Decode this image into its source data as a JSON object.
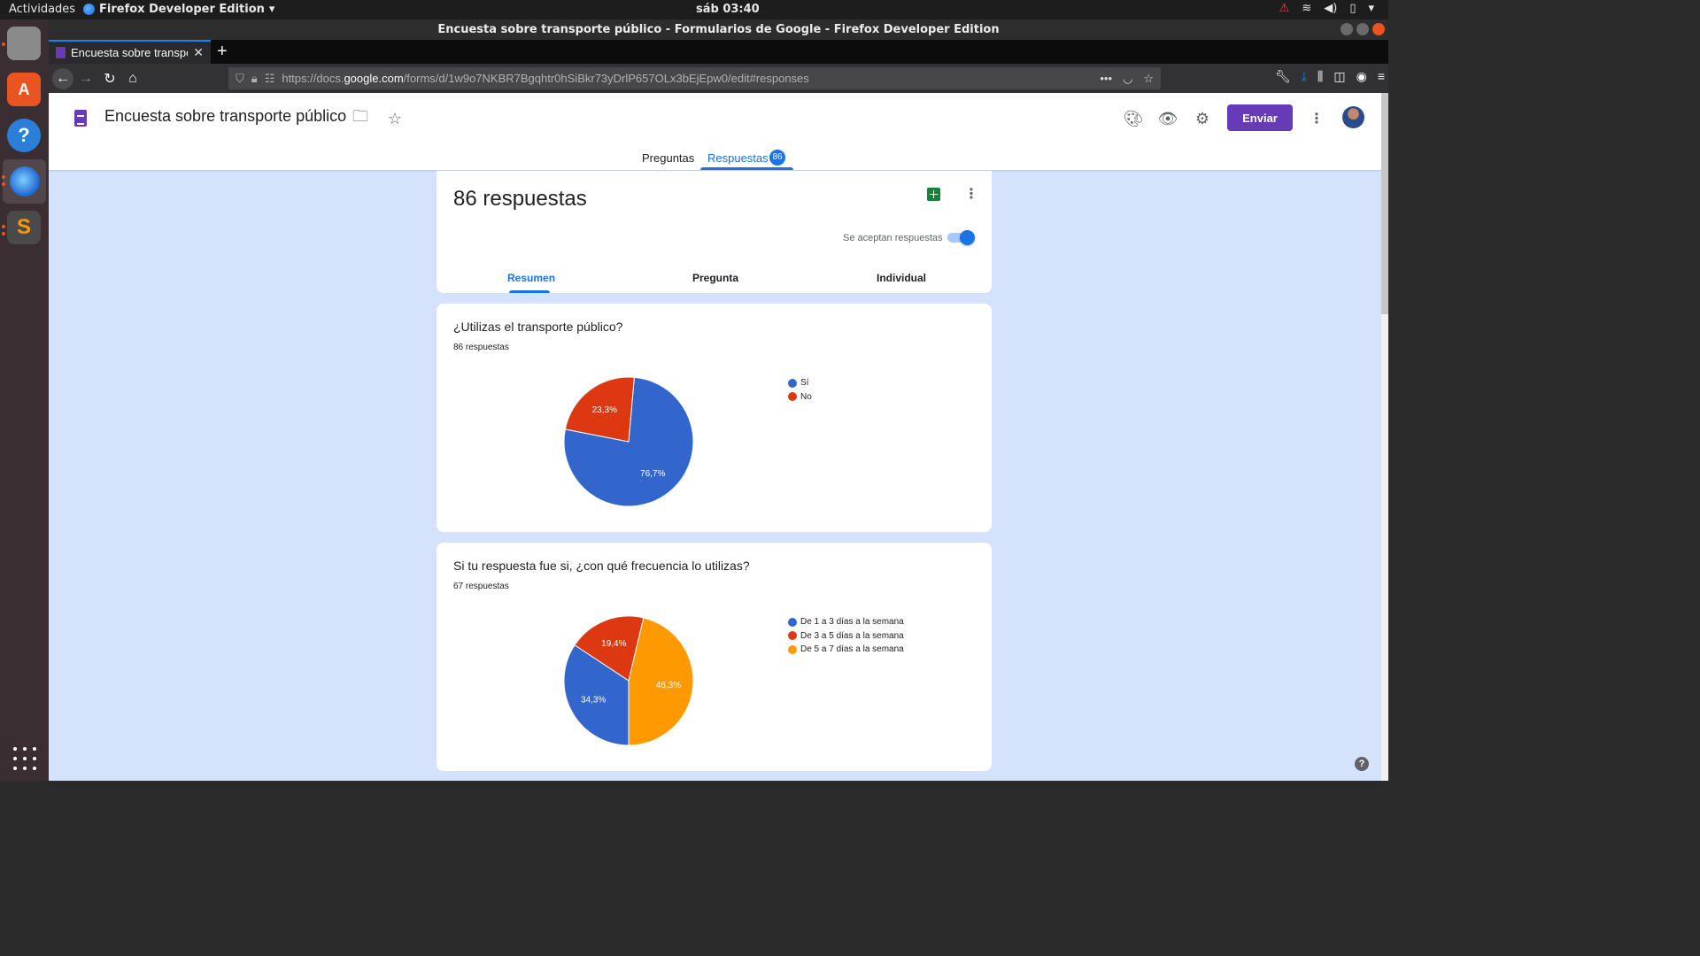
{
  "os": {
    "activities": "Actividades",
    "app_menu": "Firefox Developer Edition",
    "clock": "sáb 03:40"
  },
  "window": {
    "title": "Encuesta sobre transporte público - Formularios de Google - Firefox Developer Edition"
  },
  "browser": {
    "tab_title": "Encuesta sobre transpor",
    "url_prefix": "https://docs.",
    "url_domain": "google.com",
    "url_path": "/forms/d/1w9o7NKBR7Bgqhtr0hSiBkr73yDrlP657OLx3bEjEpw0/edit#responses"
  },
  "form": {
    "title": "Encuesta sobre transporte público",
    "send_label": "Enviar",
    "tabs": {
      "questions": "Preguntas",
      "responses": "Respuestas",
      "responses_badge": "86"
    }
  },
  "summary": {
    "count_label": "86 respuestas",
    "accepting_label": "Se aceptan respuestas",
    "accepting": true,
    "subtabs": [
      "Resumen",
      "Pregunta",
      "Individual"
    ]
  },
  "questions": [
    {
      "title": "¿Utilizas el transporte público?",
      "count_label": "86 respuestas"
    },
    {
      "title": "Si tu respuesta fue si, ¿con qué frecuencia lo utilizas?",
      "count_label": "67 respuestas"
    }
  ],
  "chart_data": [
    {
      "type": "pie",
      "title": "¿Utilizas el transporte público?",
      "categories": [
        "Sí",
        "No"
      ],
      "values": [
        76.7,
        23.3
      ],
      "labels": [
        "76,7%",
        "23,3%"
      ],
      "colors": [
        "#3366cc",
        "#dc3912"
      ],
      "legend": "right"
    },
    {
      "type": "pie",
      "title": "Si tu respuesta fue si, ¿con qué frecuencia lo utilizas?",
      "categories": [
        "De 1 a 3 días a la semana",
        "De 3 a 5 días a la semana",
        "De 5 a 7 días a la semana"
      ],
      "values": [
        34.3,
        19.4,
        46.3
      ],
      "labels": [
        "34,3%",
        "19,4%",
        "46,3%"
      ],
      "colors": [
        "#3366cc",
        "#dc3912",
        "#ff9900"
      ],
      "legend": "right"
    }
  ]
}
